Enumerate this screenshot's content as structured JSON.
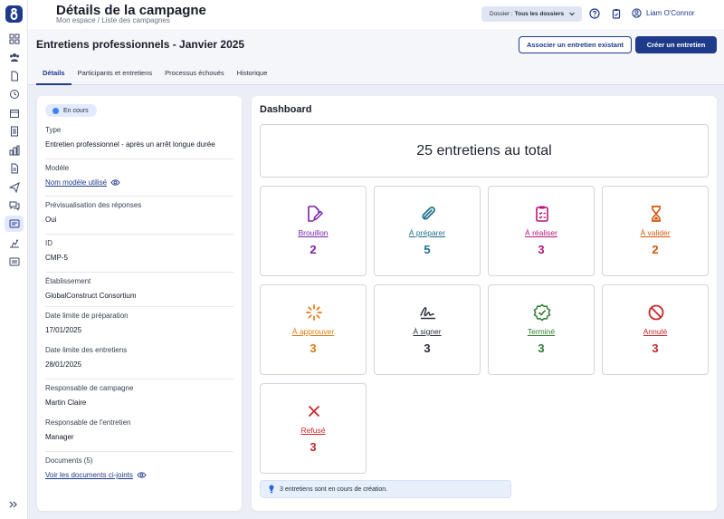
{
  "page": {
    "title": "Détails de la campagne",
    "breadcrumb": "Mon espace / Liste des campagnes"
  },
  "topbar": {
    "dossier_prefix": "Dossier :",
    "dossier_value": "Tous les dossiers",
    "user_name": "Liam O'Connor",
    "icons": [
      "help-icon",
      "clipboard-icon",
      "user-circle-icon"
    ]
  },
  "campaign": {
    "title": "Entretiens professionnels - Janvier 2025",
    "associate_button": "Associer  un entretien existant",
    "create_button": "Créer un entretien",
    "tabs": [
      "Détails",
      "Participants et entretiens",
      "Processus échoués",
      "Historique"
    ],
    "active_tab": "Détails"
  },
  "details": {
    "status": "En cours",
    "fields": {
      "type_label": "Type",
      "type_value": "Entretien professionnel - après un arrêt longue durée",
      "modele_label": "Modèle",
      "modele_value": "Nom modèle utilisé",
      "preview_label": "Prévisualisation des réponses",
      "preview_value": "Oui",
      "id_label": "ID",
      "id_value": "CMP-5",
      "etab_label": "Établissement",
      "etab_value": "GlobalConstruct Consortium",
      "prep_label": "Date limite de préparation",
      "prep_value": "17/01/2025",
      "ent_label": "Date limite des entretiens",
      "ent_value": "28/01/2025",
      "resp_camp_label": "Responsable de campagne",
      "resp_camp_value": "Martin Claire",
      "resp_ent_label": "Responsable de l'entretien",
      "resp_ent_value": "Manager",
      "docs_label": "Documents (5)",
      "docs_value": "Voir les documents ci-joints"
    }
  },
  "dashboard": {
    "title": "Dashboard",
    "total": "25 entretiens au total",
    "stats": [
      {
        "label": "Brouillon",
        "count": "2",
        "color": "#7b22a8",
        "icon": "edit-document-icon"
      },
      {
        "label": "À préparer",
        "count": "5",
        "color": "#1f6f8b",
        "icon": "paperclip-icon"
      },
      {
        "label": "À réaliser",
        "count": "3",
        "color": "#b5177a",
        "icon": "clipboard-check-icon"
      },
      {
        "label": "À valider",
        "count": "2",
        "color": "#d2570d",
        "icon": "hourglass-icon"
      },
      {
        "label": "À approuver",
        "count": "3",
        "color": "#e07a10",
        "icon": "spinner-icon"
      },
      {
        "label": "À signer",
        "count": "3",
        "color": "#2a2f3d",
        "icon": "signature-icon"
      },
      {
        "label": "Terminé",
        "count": "3",
        "color": "#2e7d32",
        "icon": "check-badge-icon"
      },
      {
        "label": "Annulé",
        "count": "3",
        "color": "#c62828",
        "icon": "cancel-icon"
      },
      {
        "label": "Refusé",
        "count": "3",
        "color": "#c62828",
        "icon": "close-icon"
      }
    ],
    "info": "3 entretiens sont en cours de création."
  },
  "colors": {
    "brand": "#1e3a8a",
    "status_dot": "#3b82f6"
  }
}
